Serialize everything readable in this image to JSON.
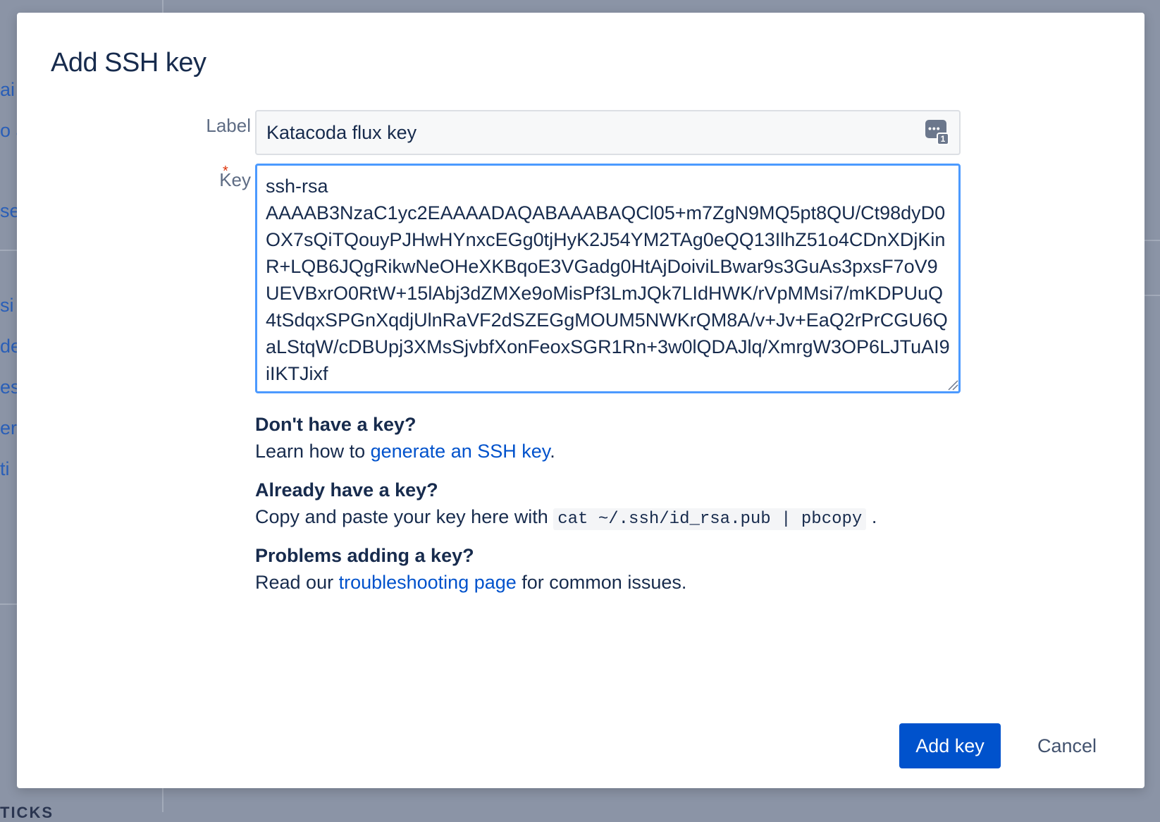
{
  "background": {
    "fragments": [
      "ai",
      "o a",
      "se",
      "si",
      "de",
      "es",
      "er",
      "ti"
    ],
    "bottom_text": "TICKS"
  },
  "dialog": {
    "title": "Add SSH key",
    "label_field": {
      "label": "Label",
      "value": "Katacoda flux key",
      "icon": "password-manager-icon",
      "badge": "1"
    },
    "key_field": {
      "label": "Key",
      "required_marker": "*",
      "value": "ssh-rsa\nAAAAB3NzaC1yc2EAAAADAQABAAABAQCl05+m7ZgN9MQ5pt8QU/Ct98dyD0OX7sQiTQouyPJHwHYnxcEGg0tjHyK2J54YM2TAg0eQQ13IlhZ51o4CDnXDjKinR+LQB6JQgRikwNeOHeXKBqoE3VGadg0HtAjDoiviLBwar9s3GuAs3pxsF7oV9UEVBxrO0RtW+15lAbj3dZMXe9oMisPf3LmJQk7LIdHWK/rVpMMsi7/mKDPUuQ4tSdqxSPGnXqdjUlnRaVF2dSZEGgMOUM5NWKrQM8A/v+Jv+EaQ2rPrCGU6QaLStqW/cDBUpj3XMsSjvbfXonFeoxSGR1Rn+3w0lQDAJlq/XmrgW3OP6LJTuAI9iIKTJixf"
    },
    "help": {
      "no_key": {
        "heading": "Don't have a key?",
        "prefix": "Learn how to ",
        "link": "generate an SSH key",
        "suffix": "."
      },
      "have_key": {
        "heading": "Already have a key?",
        "prefix": "Copy and paste your key here with ",
        "code": "cat ~/.ssh/id_rsa.pub | pbcopy",
        "suffix": " ."
      },
      "problems": {
        "heading": "Problems adding a key?",
        "prefix": "Read our ",
        "link": "troubleshooting page",
        "suffix": " for common issues."
      }
    },
    "buttons": {
      "submit": "Add key",
      "cancel": "Cancel"
    },
    "colors": {
      "primary": "#0052cc",
      "focus_border": "#4c9aff",
      "heading": "#172b4d",
      "overlay": "#8b94a6"
    }
  }
}
